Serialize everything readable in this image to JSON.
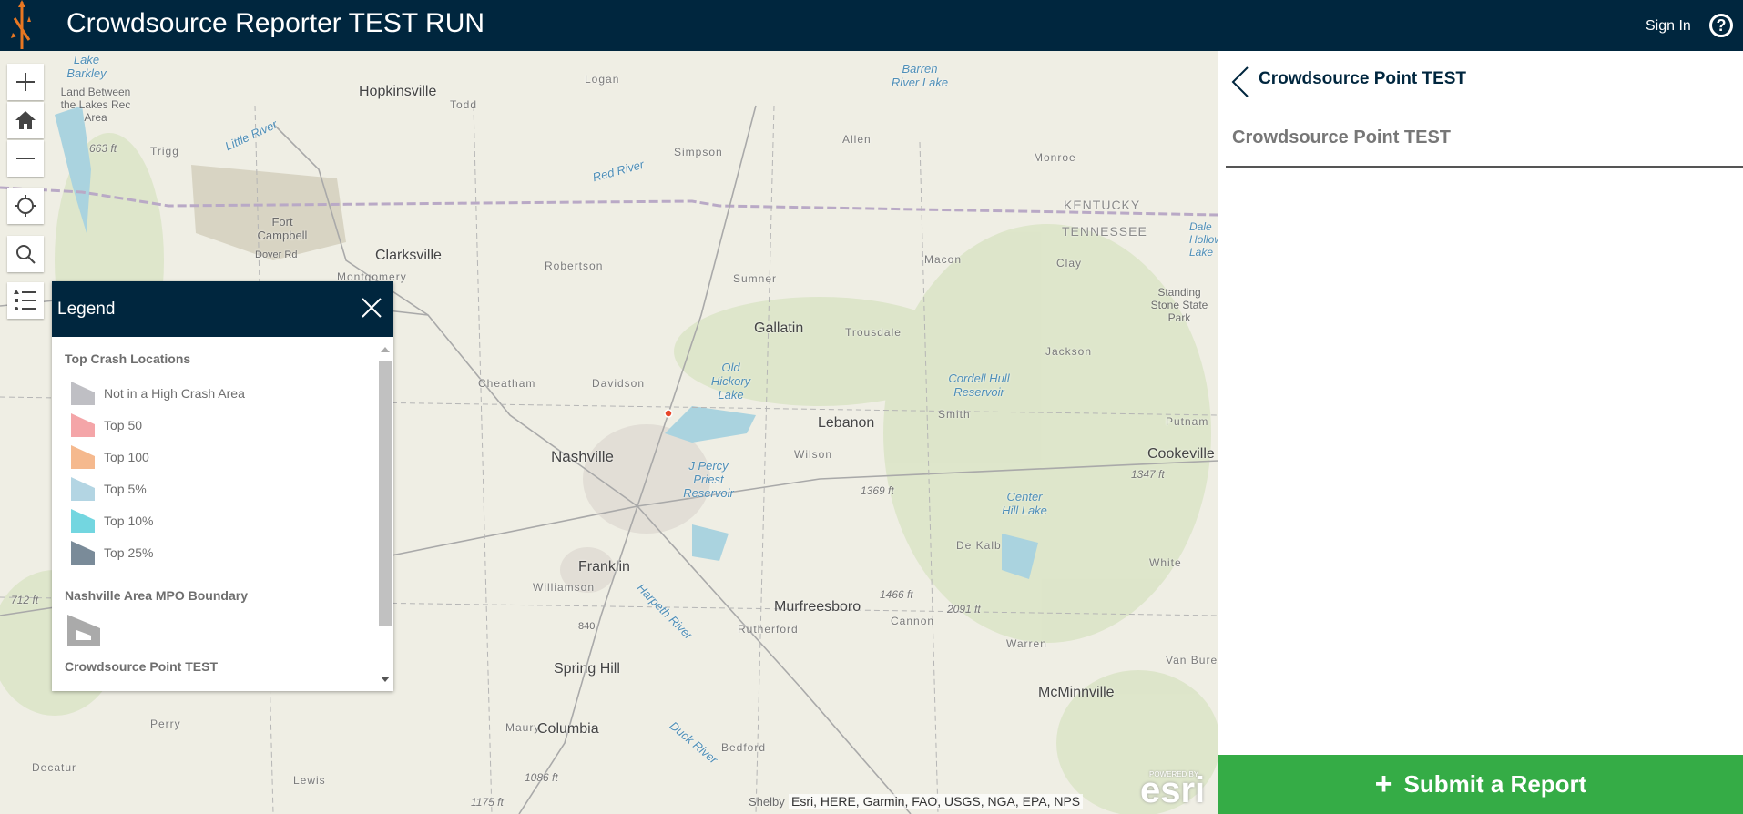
{
  "header": {
    "title": "Crowdsource Reporter TEST RUN",
    "sign_in": "Sign In",
    "help": "?"
  },
  "map": {
    "labels": [
      {
        "text": "Hopkinsville"
      },
      {
        "text": "Todd"
      },
      {
        "text": "Logan"
      },
      {
        "text": "Simpson"
      },
      {
        "text": "Allen"
      },
      {
        "text": "Barren River Lake"
      },
      {
        "text": "Monroe"
      },
      {
        "text": "KENTUCKY"
      },
      {
        "text": "TENNESSEE"
      },
      {
        "text": "Clarksville"
      },
      {
        "text": "Fort Campbell"
      },
      {
        "text": "Montgomery"
      },
      {
        "text": "Robertson"
      },
      {
        "text": "Sumner"
      },
      {
        "text": "Macon"
      },
      {
        "text": "Clay"
      },
      {
        "text": "Gallatin"
      },
      {
        "text": "Trousdale"
      },
      {
        "text": "Jackson"
      },
      {
        "text": "Cheatham"
      },
      {
        "text": "Davidson"
      },
      {
        "text": "Old Hickory Lake"
      },
      {
        "text": "Cordell Hull Reservoir"
      },
      {
        "text": "Smith"
      },
      {
        "text": "Putnam"
      },
      {
        "text": "Lebanon"
      },
      {
        "text": "Nashville"
      },
      {
        "text": "Wilson"
      },
      {
        "text": "J Percy Priest Reservoir"
      },
      {
        "text": "1369 ft"
      },
      {
        "text": "Cookeville"
      },
      {
        "text": "1347 ft"
      },
      {
        "text": "Center Hill Lake"
      },
      {
        "text": "De Kalb"
      },
      {
        "text": "White"
      },
      {
        "text": "Franklin"
      },
      {
        "text": "Williamson"
      },
      {
        "text": "Murfreesboro"
      },
      {
        "text": "1466 ft"
      },
      {
        "text": "2091 ft"
      },
      {
        "text": "Cannon"
      },
      {
        "text": "Rutherford"
      },
      {
        "text": "Warren"
      },
      {
        "text": "Van Buren"
      },
      {
        "text": "Spring Hill"
      },
      {
        "text": "McMinnville"
      },
      {
        "text": "Maury"
      },
      {
        "text": "Columbia"
      },
      {
        "text": "Perry"
      },
      {
        "text": "Bedford"
      },
      {
        "text": "Decatur"
      },
      {
        "text": "Lewis"
      },
      {
        "text": "1086 ft"
      },
      {
        "text": "1175 ft"
      },
      {
        "text": "663 ft"
      },
      {
        "text": "712 ft"
      },
      {
        "text": "Lake Barkley"
      },
      {
        "text": "Land Between the Lakes Rec Area"
      },
      {
        "text": "Trigg"
      },
      {
        "text": "Little River"
      },
      {
        "text": "Red River"
      },
      {
        "text": "Dover Rd"
      },
      {
        "text": "Harpeth River"
      },
      {
        "text": "Duck River"
      },
      {
        "text": "Standing Stone State Park"
      },
      {
        "text": "Dale Hollow Lake"
      },
      {
        "text": "840"
      },
      {
        "text": "Shelby"
      }
    ],
    "attribution": "Esri, HERE, Garmin, FAO, USGS, NGA, EPA, NPS",
    "esri_logo": "esri",
    "esri_powered": "POWERED BY"
  },
  "legend": {
    "title": "Legend",
    "sections": [
      {
        "title": "Top Crash Locations",
        "items": [
          {
            "label": "Not in a High Crash Area",
            "color": "#bfbfc4"
          },
          {
            "label": "Top 50",
            "color": "#f4a5a8"
          },
          {
            "label": "Top 100",
            "color": "#f5b98e"
          },
          {
            "label": "Top 5%",
            "color": "#b3d5e3"
          },
          {
            "label": "Top 10%",
            "color": "#73d6e0"
          },
          {
            "label": "Top 25%",
            "color": "#7a8b99"
          }
        ]
      },
      {
        "title": "Nashville Area MPO Boundary"
      },
      {
        "title": "Crowdsource Point TEST"
      }
    ]
  },
  "panel": {
    "title": "Crowdsource Point TEST",
    "subtitle": "Crowdsource Point TEST",
    "submit": "Submit a Report",
    "submit_icon": "+"
  },
  "colors": {
    "header": "#00263e",
    "submit": "#35ac46"
  }
}
